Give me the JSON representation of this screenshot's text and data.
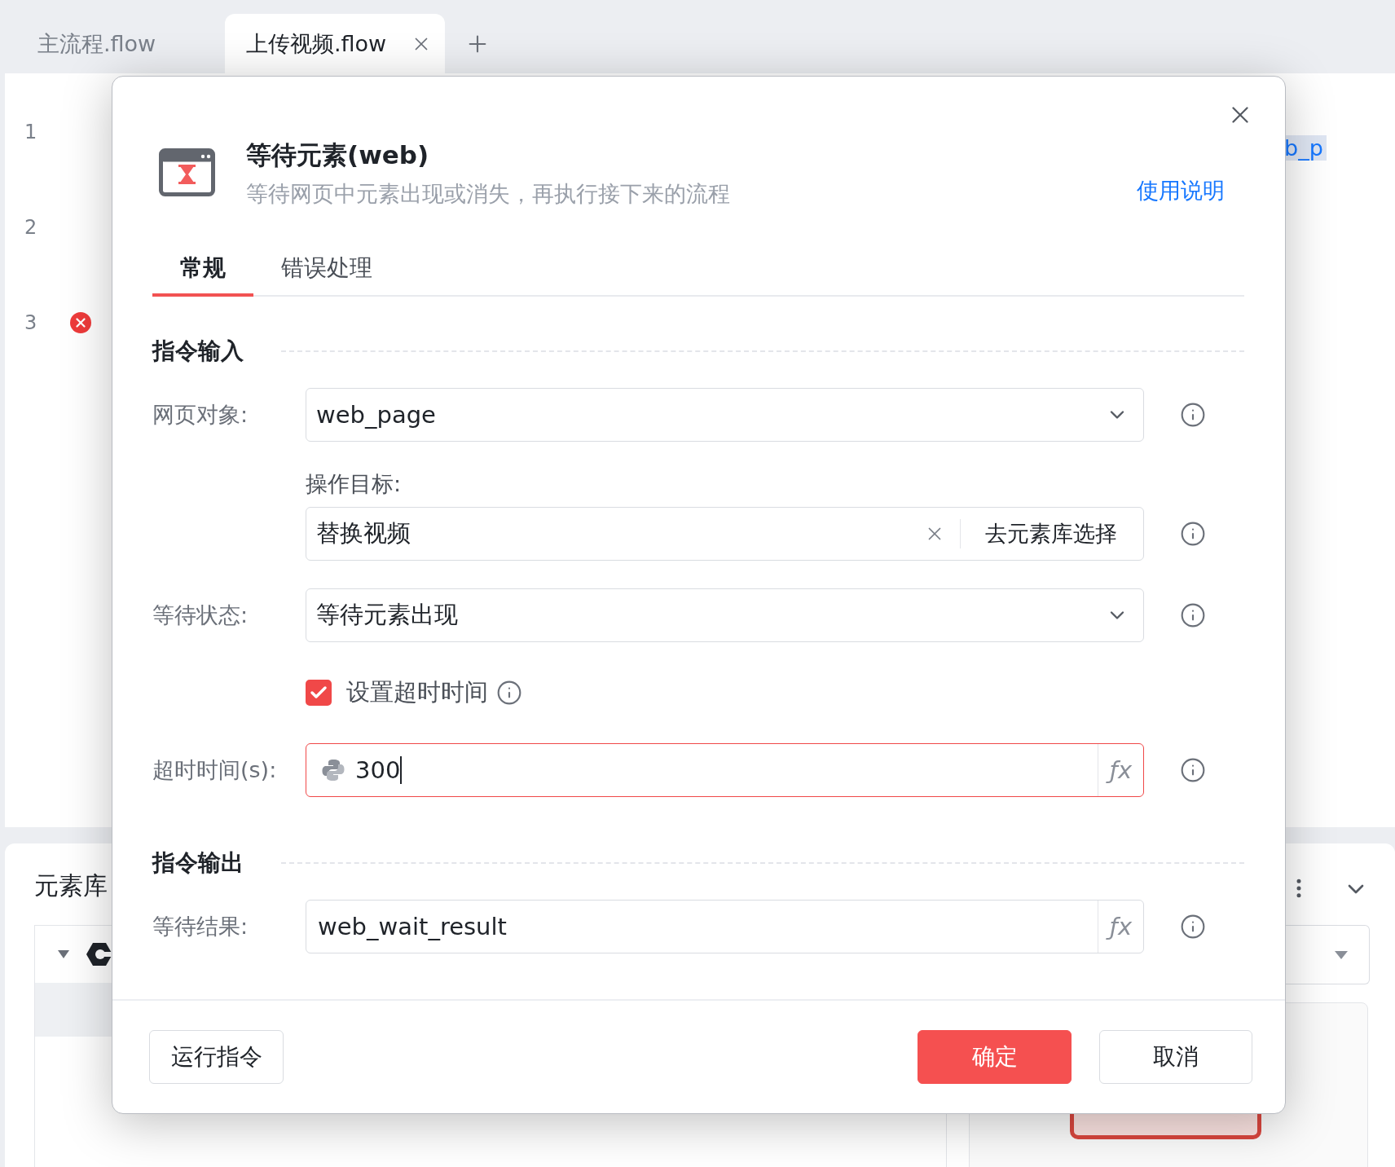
{
  "tabs": [
    {
      "label": "主流程.flow",
      "selected": false,
      "closable": false
    },
    {
      "label": "上传视频.flow",
      "selected": true,
      "closable": true
    }
  ],
  "editor": {
    "lines": [
      {
        "number": "1",
        "error": false
      },
      {
        "number": "2",
        "error": false
      },
      {
        "number": "3",
        "error": true
      }
    ],
    "code_fragment": "b_p"
  },
  "bottom_panel": {
    "title": "元素库"
  },
  "dialog": {
    "title": "等待元素(web)",
    "description": "等待网页中元素出现或消失，再执行接下来的流程",
    "help_link": "使用说明",
    "tabs": [
      {
        "label": "常规",
        "selected": true
      },
      {
        "label": "错误处理",
        "selected": false
      }
    ],
    "sections": [
      {
        "title": "指令输入",
        "fields": [
          {
            "kind": "select",
            "label": "网页对象:",
            "value": "web_page"
          },
          {
            "kind": "picker",
            "label": "操作目标:",
            "value": "替换视频",
            "action": "去元素库选择"
          },
          {
            "kind": "select",
            "label": "等待状态:",
            "value": "等待元素出现"
          },
          {
            "kind": "checkbox",
            "label": "设置超时时间",
            "checked": true
          },
          {
            "kind": "expression",
            "label": "超时时间(s):",
            "value": "300",
            "focused": true,
            "python": true,
            "function_button": "ƒx"
          }
        ]
      },
      {
        "title": "指令输出",
        "fields": [
          {
            "kind": "expression",
            "label": "等待结果:",
            "value": "web_wait_result",
            "focused": false,
            "python": false,
            "function_button": "ƒx"
          }
        ]
      }
    ],
    "run_button": "运行指令",
    "confirm_button": "确定",
    "cancel_button": "取消"
  }
}
